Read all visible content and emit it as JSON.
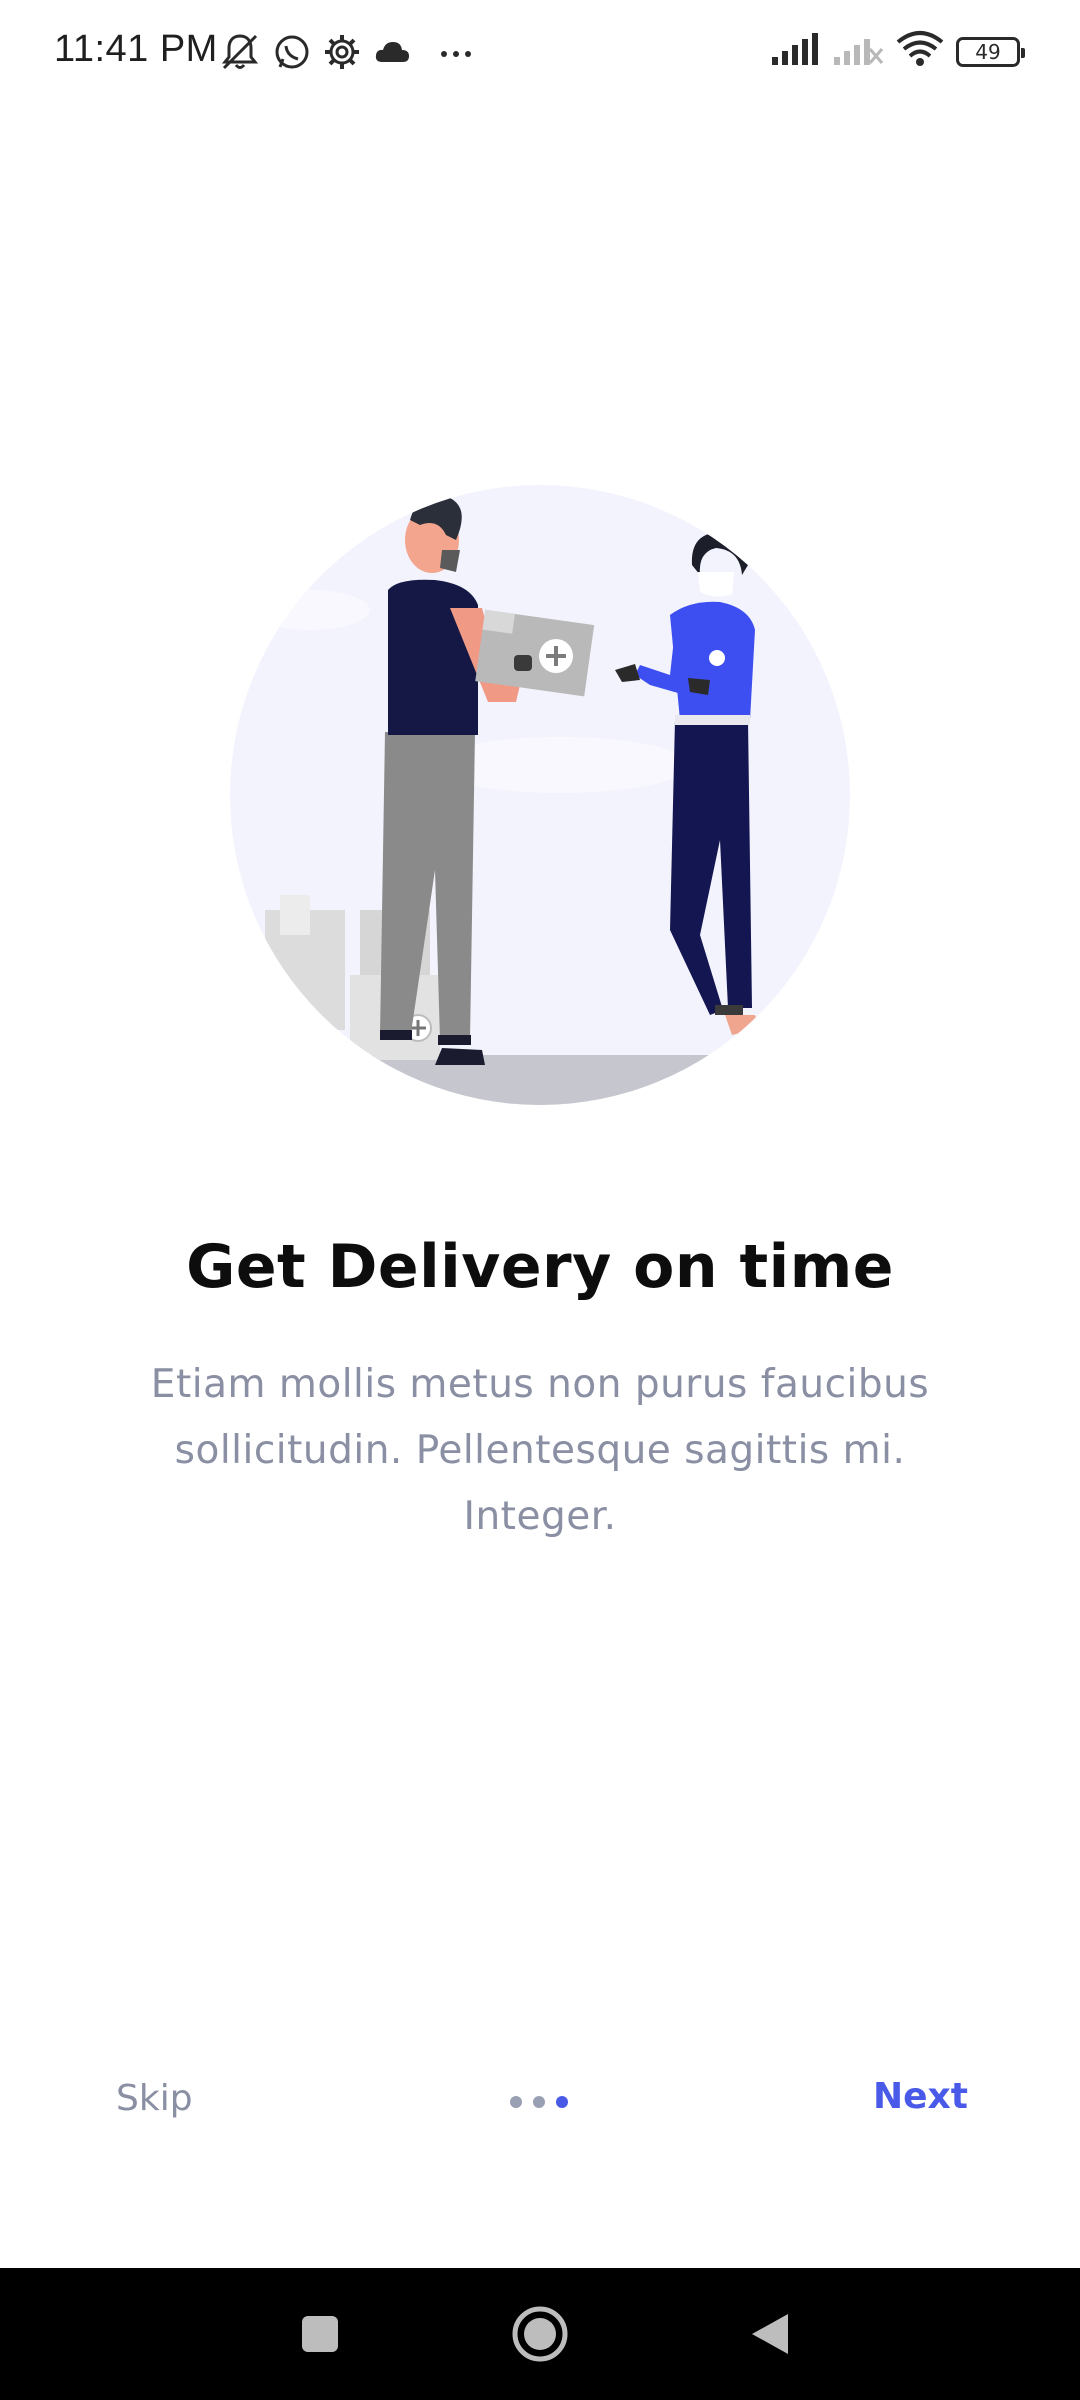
{
  "status_bar": {
    "time": "11:41 PM",
    "battery_level": "49",
    "left_icons": [
      "bell-off-icon",
      "whatsapp-icon",
      "settings-gear-icon",
      "cloud-icon",
      "more-dots-icon"
    ],
    "right_icons": [
      "signal-full-icon",
      "signal-no-service-icon",
      "wifi-icon",
      "battery-icon"
    ]
  },
  "onboarding": {
    "illustration": "delivery-handoff-illustration",
    "title": "Get Delivery on time",
    "subtitle": "Etiam mollis metus non purus faucibus sollicitudin. Pellentesque sagittis mi. Integer.",
    "skip_label": "Skip",
    "next_label": "Next",
    "page_count": 3,
    "active_page": 3
  },
  "colors": {
    "accent": "#4a5ae8",
    "muted_text": "#8a8fa3",
    "title_text": "#0d0d0d"
  },
  "nav_bar": {
    "buttons": [
      "recents-square-icon",
      "home-circle-icon",
      "back-triangle-icon"
    ]
  }
}
